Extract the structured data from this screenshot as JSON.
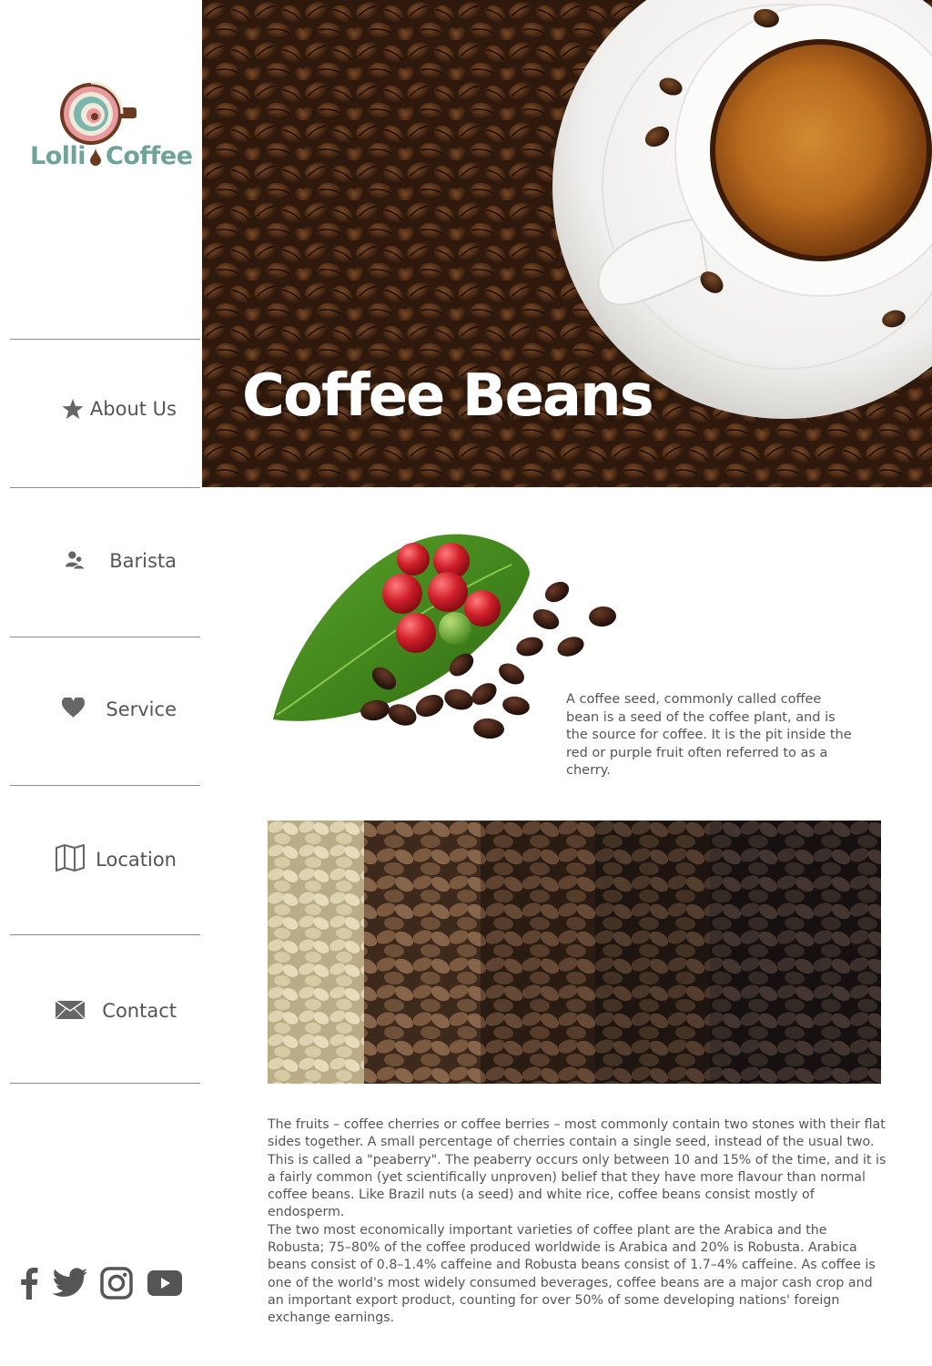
{
  "brand": {
    "name_left": "Lolli",
    "name_right": "Coffee"
  },
  "nav": [
    {
      "label": "About Us",
      "icon": "star-icon"
    },
    {
      "label": "Barista",
      "icon": "users-icon"
    },
    {
      "label": "Service",
      "icon": "heart-icon"
    },
    {
      "label": "Location",
      "icon": "map-icon"
    },
    {
      "label": "Contact",
      "icon": "envelope-icon"
    }
  ],
  "social": [
    "facebook-icon",
    "twitter-icon",
    "instagram-icon",
    "youtube-icon"
  ],
  "hero": {
    "title": "Coffee Beans"
  },
  "intro": "A coffee seed, commonly called coffee bean is a seed of the coffee plant, and is the source for coffee. It is the pit inside the red or purple fruit often referred to as a cherry.",
  "body": {
    "p1": "The fruits – coffee cherries or coffee berries – most commonly contain two stones with their flat sides together. A small percentage of cherries contain a single seed, instead of the usual two. This is called a \"peaberry\". The peaberry occurs only between 10 and 15% of the time, and it is a fairly common (yet scientifically unproven) belief that they have more flavour than normal coffee beans. Like Brazil nuts (a seed) and white rice, coffee beans consist mostly of endosperm.",
    "p2": "The two most economically important varieties of coffee plant are the Arabica and the Robusta; 75–80% of the coffee produced worldwide is Arabica and 20% is Robusta. Arabica beans consist of 0.8–1.4% caffeine and Robusta beans consist of 1.7–4% caffeine. As coffee is one of the world's most widely consumed beverages, coffee beans are a major cash crop and an important export product, counting for over 50% of some developing nations' foreign exchange earnings."
  },
  "colors": {
    "brand_teal": "#6fa39a",
    "brand_brown": "#6b3a1f",
    "text": "#555555"
  }
}
